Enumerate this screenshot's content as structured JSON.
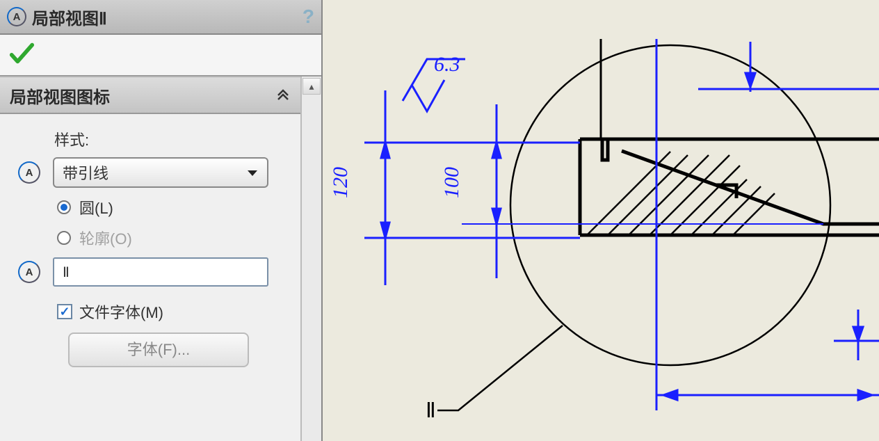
{
  "panel": {
    "title": "局部视图Ⅱ",
    "section_header": "局部视图图标",
    "style_label": "样式:",
    "dropdown_selected": "带引线",
    "radio_circle": "圆(L)",
    "radio_outline": "轮廓(O)",
    "label_input_value": "Ⅱ",
    "check_file_font": "文件字体(M)",
    "font_button": "字体(F)..."
  },
  "drawing": {
    "surface_value": "6.3",
    "dim_120": "120",
    "dim_100": "100",
    "call_label": "Ⅱ"
  }
}
